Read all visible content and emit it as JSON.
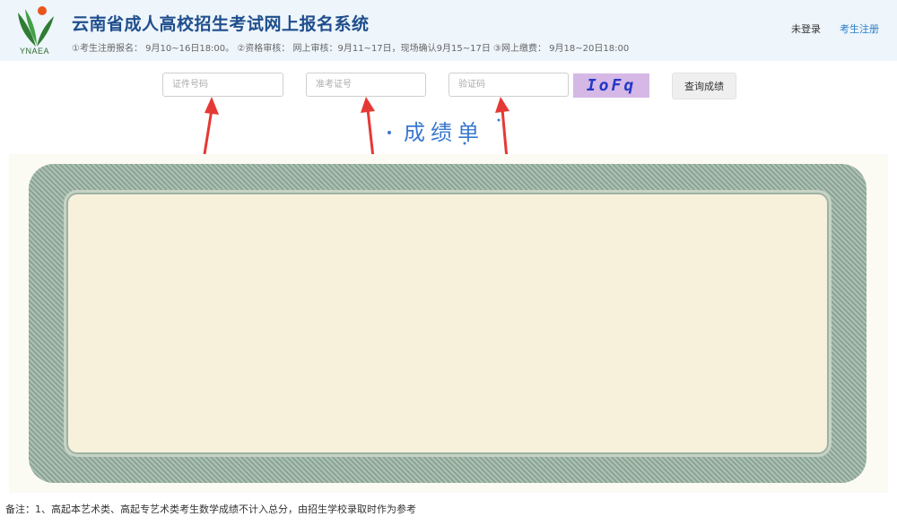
{
  "header": {
    "logo_text": "YNAEA",
    "title": "云南省成人高校招生考试网上报名系统",
    "schedule": "①考生注册报名： 9月10~16日18:00。 ②资格审核： 网上审核：9月11~17日，现场确认9月15~17日 ③网上缴费： 9月18~20日18:00",
    "login_label": "未登录",
    "register_label": "考生注册"
  },
  "search": {
    "id_placeholder": "证件号码",
    "exam_placeholder": "准考证号",
    "captcha_placeholder": "验证码",
    "captcha_text": "IoFq",
    "query_label": "查询成绩"
  },
  "sheet": {
    "title": "成绩单"
  },
  "footer": {
    "remark": "备注：1、高起本艺术类、高起专艺术类考生数学成绩不计入总分，由招生学校录取时作为参考"
  },
  "colors": {
    "title_blue": "#1f4e8c",
    "link_blue": "#2a7ec8",
    "captcha_bg": "#d6b8e6",
    "arrow_red": "#e53935"
  }
}
